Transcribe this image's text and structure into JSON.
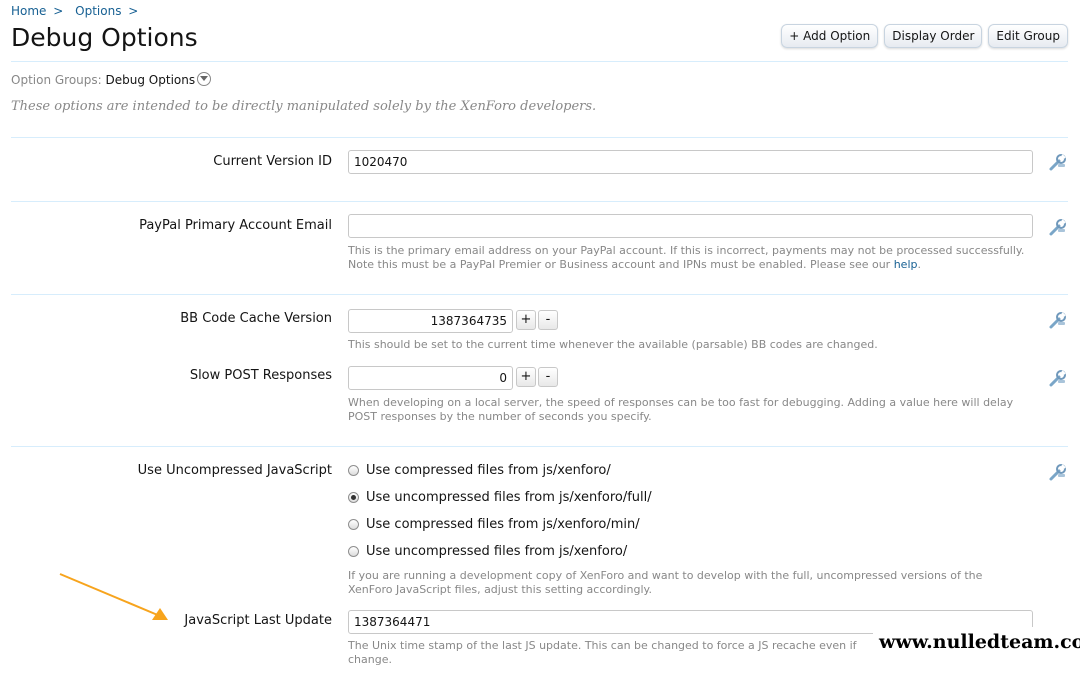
{
  "breadcrumb": {
    "home": "Home",
    "options": "Options",
    "separator": ">"
  },
  "page_title": "Debug Options",
  "toolbar": {
    "add_option": "+ Add Option",
    "display_order": "Display Order",
    "edit_group": "Edit Group"
  },
  "option_groups": {
    "label": "Option Groups:",
    "value": "Debug Options"
  },
  "group_description": "These options are intended to be directly manipulated solely by the XenForo developers.",
  "options": {
    "current_version": {
      "label": "Current Version ID",
      "value": "1020470"
    },
    "paypal_email": {
      "label": "PayPal Primary Account Email",
      "value": "",
      "hint_line1": "This is the primary email address on your PayPal account. If this is incorrect, payments may not be processed successfully.",
      "hint_line2": "Note this must be a PayPal Premier or Business account and IPNs must be enabled. Please see our",
      "hint_link": "help",
      "hint_end": "."
    },
    "bbcode_cache": {
      "label": "BB Code Cache Version",
      "value": "1387364735",
      "hint": "This should be set to the current time whenever the available (parsable) BB codes are changed."
    },
    "slow_post": {
      "label": "Slow POST Responses",
      "value": "0",
      "hint_line1": "When developing on a local server, the speed of responses can be too fast for debugging. Adding a value here will delay",
      "hint_line2": "POST responses by the number of seconds you specify."
    },
    "uncompressed_js": {
      "label": "Use Uncompressed JavaScript",
      "choices": [
        "Use compressed files from js/xenforo/",
        "Use uncompressed files from js/xenforo/full/",
        "Use compressed files from js/xenforo/min/",
        "Use uncompressed files from js/xenforo/"
      ],
      "selected_index": 1,
      "hint_line1": "If you are running a development copy of XenForo and want to develop with the full, uncompressed versions of the",
      "hint_line2": "XenForo JavaScript files, adjust this setting accordingly."
    },
    "js_last_update": {
      "label": "JavaScript Last Update",
      "value": "1387364471",
      "hint_line1": "The Unix time stamp of the last JS update. This can be changed to force a JS recache even if",
      "hint_line2": "change."
    }
  },
  "spinner": {
    "plus": "+",
    "minus": "-"
  },
  "watermark": "www.nulledteam.com",
  "colors": {
    "link": "#176093",
    "hint": "#888888",
    "rule": "#d7edfc",
    "arrow": "#f7a41d"
  }
}
